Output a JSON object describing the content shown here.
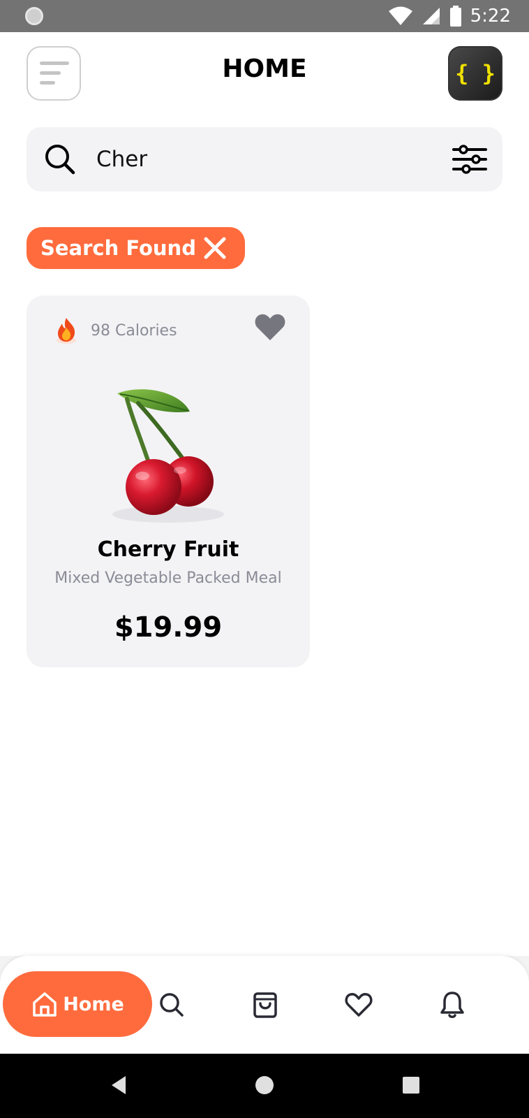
{
  "status_bar": {
    "time": "5:22",
    "icons": [
      "wifi-icon",
      "cell-signal-icon",
      "battery-icon"
    ]
  },
  "header": {
    "title": "HOME",
    "avatar_text": "{ }",
    "menu_icon": "menu-icon"
  },
  "search": {
    "value": "Cher",
    "placeholder": "Search"
  },
  "filter_chip": {
    "label": "Search Found",
    "close_icon": "close-icon"
  },
  "products": [
    {
      "calories": "98 Calories",
      "name": "Cherry Fruit",
      "description": "Mixed Vegetable Packed Meal",
      "price": "$19.99"
    }
  ],
  "bottom_nav": {
    "items": [
      {
        "label": "Home",
        "icon": "home-icon",
        "active": true
      },
      {
        "label": "",
        "icon": "search-icon",
        "active": false
      },
      {
        "label": "",
        "icon": "shopping-bag-icon",
        "active": false
      },
      {
        "label": "",
        "icon": "heart-icon",
        "active": false
      },
      {
        "label": "",
        "icon": "bell-icon",
        "active": false
      }
    ]
  },
  "colors": {
    "accent": "#ff6b3d",
    "card_bg": "#f3f3f5",
    "muted_text": "#8b8b97"
  }
}
